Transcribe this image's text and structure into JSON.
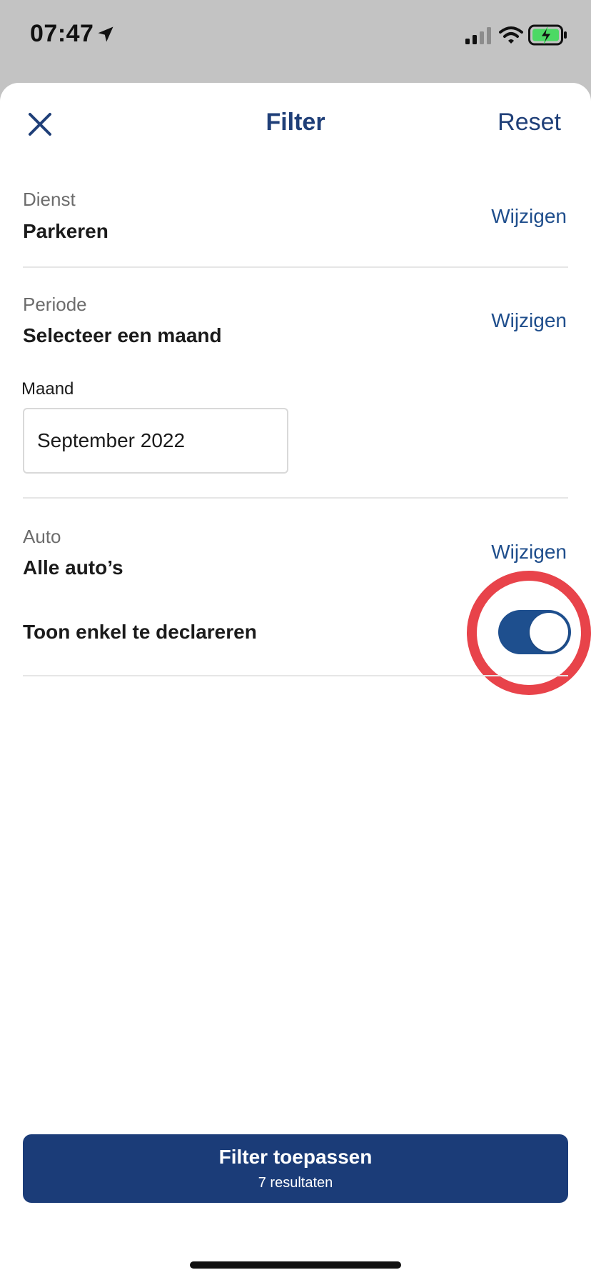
{
  "status_bar": {
    "time": "07:47",
    "icons": [
      "location-arrow-icon",
      "cellular-signal-icon",
      "wifi-icon",
      "battery-charging-icon"
    ]
  },
  "header": {
    "close_icon": "close-icon",
    "title": "Filter",
    "reset_label": "Reset"
  },
  "sections": {
    "dienst": {
      "label": "Dienst",
      "value": "Parkeren",
      "action": "Wijzigen"
    },
    "periode": {
      "label": "Periode",
      "value": "Selecteer een maand",
      "action": "Wijzigen",
      "month_field_label": "Maand",
      "month_field_value": "September 2022"
    },
    "auto": {
      "label": "Auto",
      "value": "Alle auto’s",
      "action": "Wijzigen",
      "toggle_label": "Toon enkel te declareren",
      "toggle_on": true
    }
  },
  "footer": {
    "apply_label": "Filter toepassen",
    "results_text": "7 resultaten"
  },
  "colors": {
    "primary": "#1b3c78",
    "link": "#1f4e8c",
    "highlight_ring": "#e8434a",
    "battery_green": "#4cd964"
  }
}
